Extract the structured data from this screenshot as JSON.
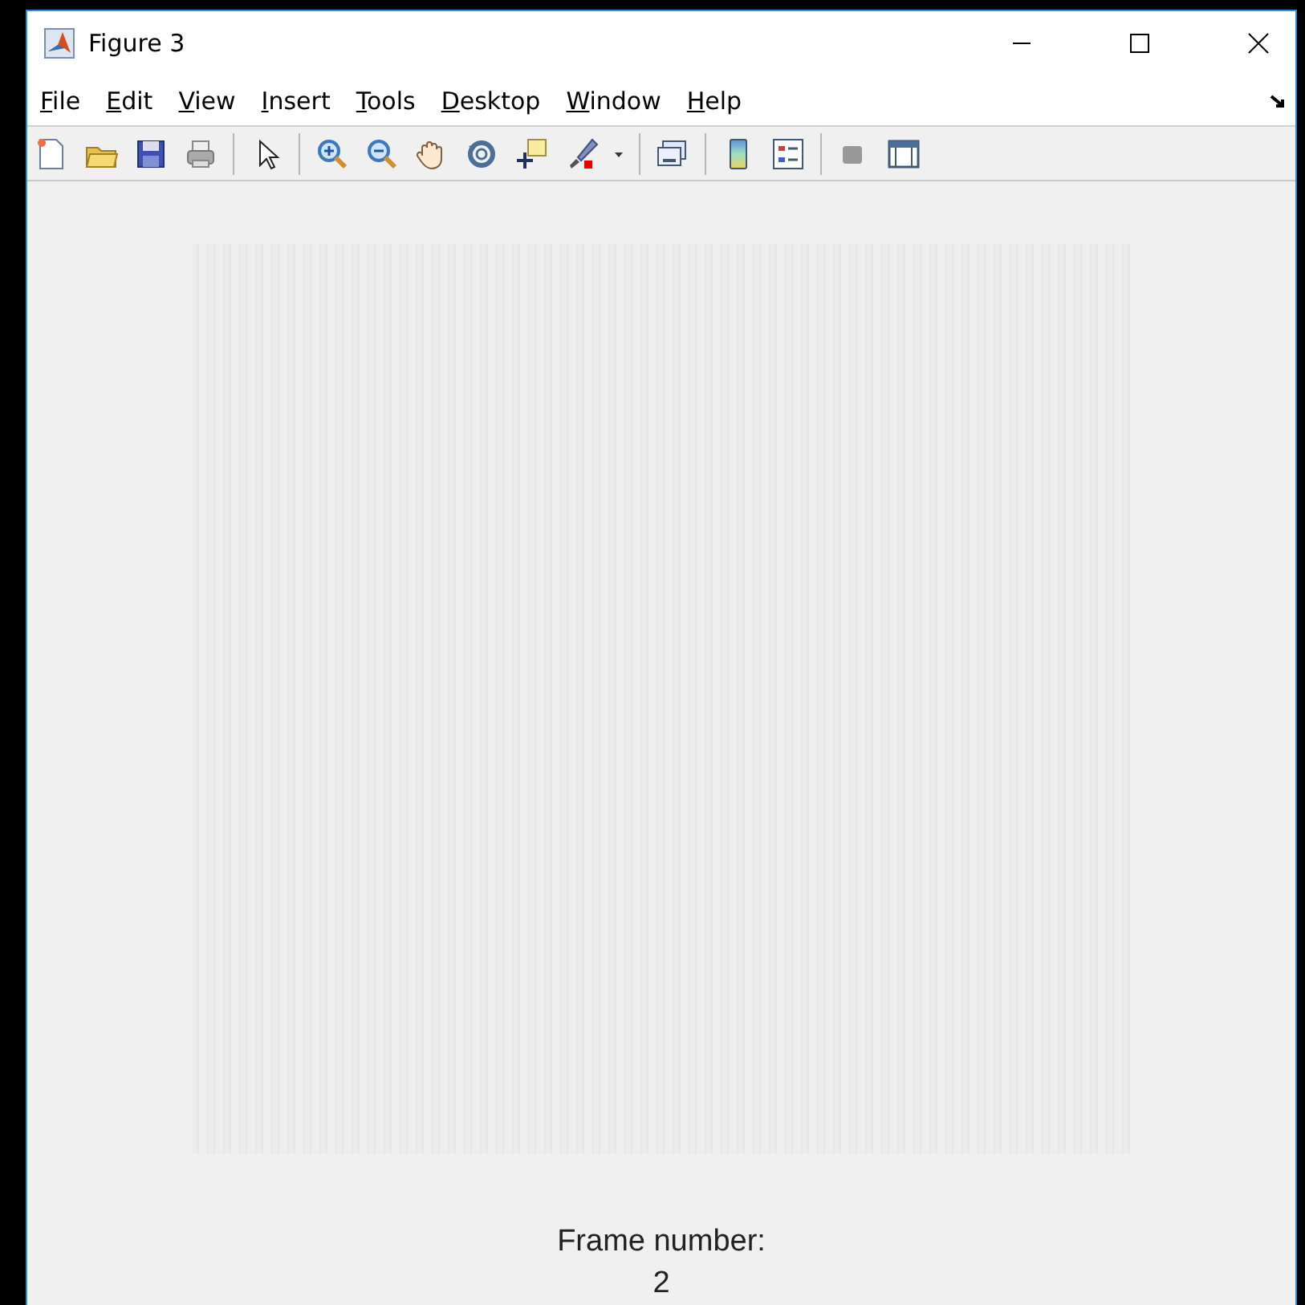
{
  "window": {
    "title": "Figure 3"
  },
  "menu": [
    "File",
    "Edit",
    "View",
    "Insert",
    "Tools",
    "Desktop",
    "Window",
    "Help"
  ],
  "caption": {
    "label": "Frame number:",
    "value": "2"
  }
}
